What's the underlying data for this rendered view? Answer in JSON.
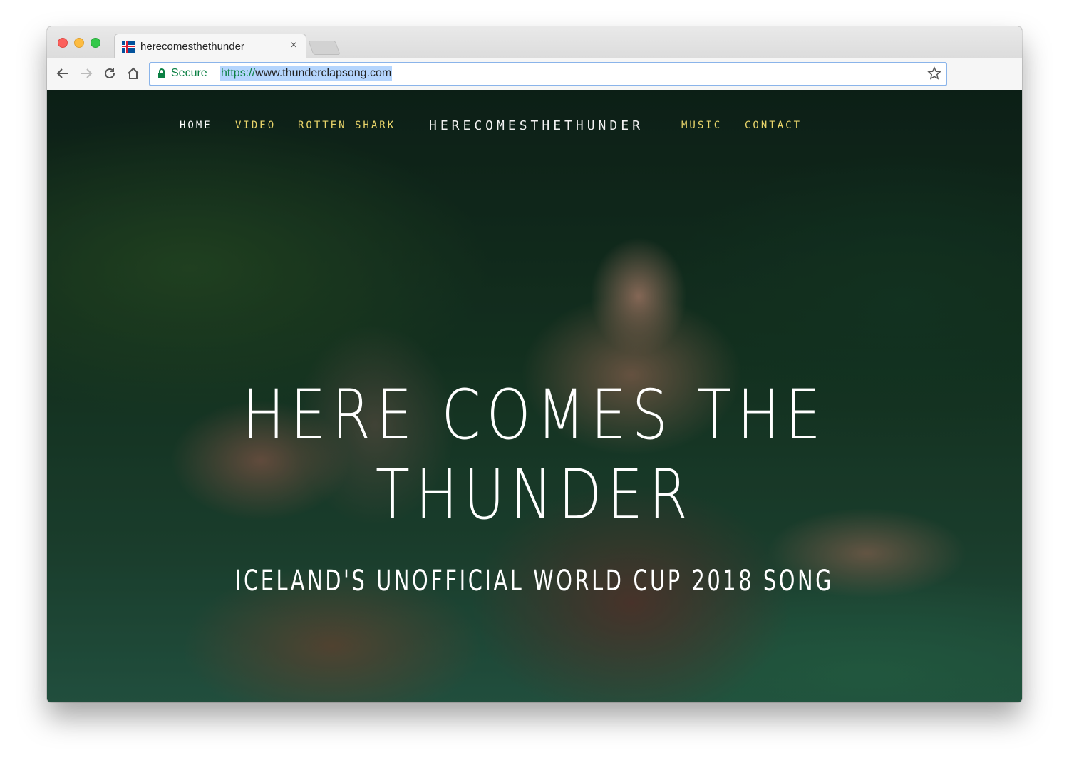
{
  "browser": {
    "tab_title": "herecomesthethunder",
    "tab_close": "×",
    "secure_label": "Secure",
    "url_scheme": "https://",
    "url_rest": "www.thunderclapsong.com",
    "icons": [
      "back-icon",
      "forward-icon",
      "reload-icon",
      "home-icon",
      "lock-icon",
      "star-icon",
      "iceland-flag-icon"
    ]
  },
  "site": {
    "nav_left": [
      "HOME",
      "VIDEO",
      "ROTTEN SHARK"
    ],
    "brand": "HERECOMESTHETHUNDER",
    "nav_right": [
      "MUSIC",
      "CONTACT"
    ],
    "hero_line1": "HERE COMES THE",
    "hero_line2": "THUNDER",
    "hero_subtitle": "ICELAND'S UNOFFICIAL WORLD CUP 2018 SONG"
  },
  "colors": {
    "nav_accent": "#e8d46a",
    "secure_green": "#0b8043",
    "url_highlight": "#b5d5fd"
  }
}
